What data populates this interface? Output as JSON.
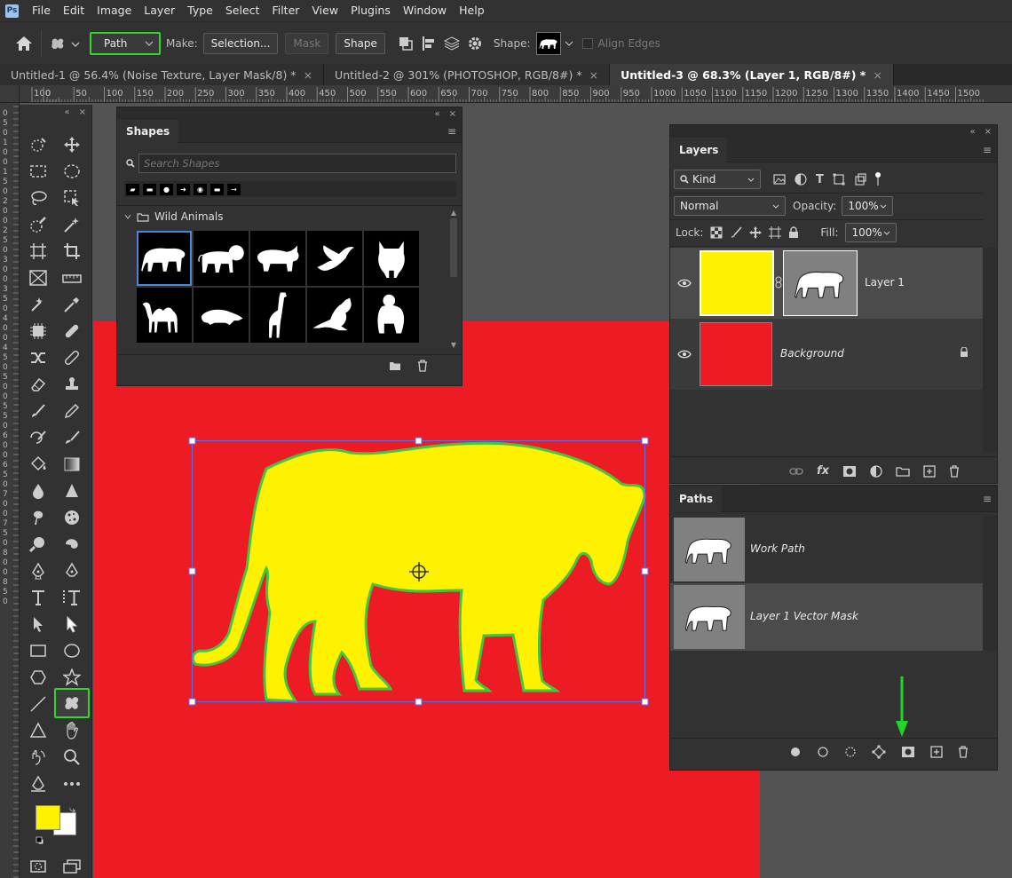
{
  "menu": {
    "logo": "Ps",
    "items": [
      "File",
      "Edit",
      "Image",
      "Layer",
      "Type",
      "Select",
      "Filter",
      "View",
      "Plugins",
      "Window",
      "Help"
    ]
  },
  "options": {
    "mode": "Path",
    "make_label": "Make:",
    "selection_button": "Selection...",
    "mask_button": "Mask",
    "shape_button": "Shape",
    "shape_label": "Shape:",
    "align_edges": "Align Edges"
  },
  "tabs": [
    {
      "title": "Untitled-1 @ 56.4% (Noise Texture, Layer Mask/8) *",
      "close": "×"
    },
    {
      "title": "Untitled-2 @ 301% (PHOTOSHOP, RGB/8#) *",
      "close": "×"
    },
    {
      "title": "Untitled-3 @ 68.3% (Layer 1, RGB/8#) *",
      "close": "×"
    }
  ],
  "ruler": {
    "top": [
      "100",
      "0",
      "50",
      "100",
      "150",
      "200",
      "250",
      "300",
      "350",
      "400",
      "450",
      "500",
      "550",
      "600",
      "650",
      "700",
      "750",
      "800",
      "850",
      "900",
      "950",
      "1000",
      "1050",
      "1100",
      "1150",
      "1200",
      "1250",
      "1300",
      "1350",
      "1400",
      "1450",
      "1500"
    ],
    "left": [
      "0",
      "5",
      "0",
      "1",
      "0",
      "0",
      "1",
      "5",
      "0",
      "2",
      "0",
      "0",
      "2",
      "5",
      "0",
      "3",
      "0",
      "0",
      "3",
      "5",
      "0",
      "4",
      "0",
      "0",
      "4",
      "5",
      "0",
      "5",
      "0",
      "0",
      "5",
      "5",
      "0",
      "6",
      "0",
      "0",
      "6",
      "5",
      "0",
      "7",
      "0",
      "0",
      "7",
      "5",
      "0",
      "8",
      "0",
      "0",
      "8",
      "5",
      "0"
    ]
  },
  "shapes_panel": {
    "title": "Shapes",
    "search_placeholder": "Search Shapes",
    "group": "Wild Animals"
  },
  "layers_panel": {
    "title": "Layers",
    "filter": "Kind",
    "blend_mode": "Normal",
    "opacity_label": "Opacity:",
    "opacity": "100%",
    "lock_label": "Lock:",
    "fill_label": "Fill:",
    "fill": "100%",
    "layers": [
      {
        "name": "Layer 1"
      },
      {
        "name": "Background"
      }
    ]
  },
  "paths_panel": {
    "title": "Paths",
    "paths": [
      {
        "name": "Work Path"
      },
      {
        "name": "Layer 1 Vector Mask"
      }
    ]
  },
  "colors": {
    "foreground": "#fff200",
    "background": "#ffffff",
    "canvas": "#ed1c24",
    "highlight": "#34d62a"
  }
}
